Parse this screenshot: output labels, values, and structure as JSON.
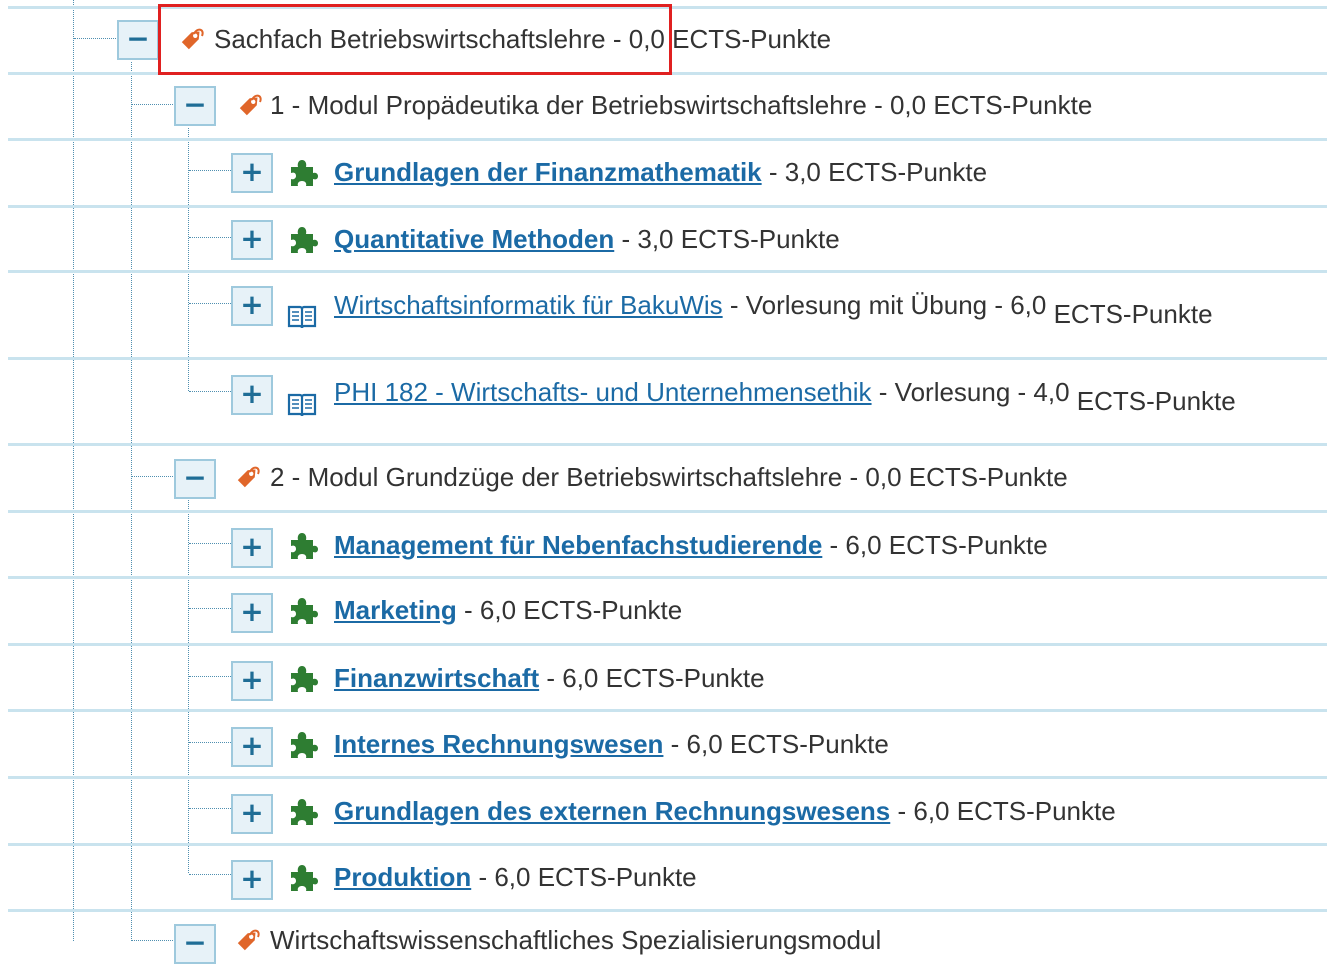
{
  "tree": {
    "root": {
      "toggle": "−",
      "label": "Sachfach Betriebswirtschaftslehre",
      "credits": " - 0,0 ECTS-Punkte",
      "highlighted": true
    },
    "modules": [
      {
        "toggle": "−",
        "label": "1 - Modul Propädeutika der Betriebswirtschaftslehre",
        "credits": " - 0,0 ECTS-Punkte",
        "children": [
          {
            "toggle": "+",
            "icon": "puzzle-piece-icon",
            "title": "Grundlagen der Finanzmathematik",
            "suffix": " - 3,0 ECTS-Punkte"
          },
          {
            "toggle": "+",
            "icon": "puzzle-piece-icon",
            "title": "Quantitative Methoden",
            "suffix": " - 3,0 ECTS-Punkte"
          },
          {
            "toggle": "+",
            "icon": "open-book-icon",
            "title": "Wirtschaftsinformatik für BakuWis",
            "suffix": " - Vorlesung mit Übung - 6,0",
            "suffix2": "ECTS-Punkte"
          },
          {
            "toggle": "+",
            "icon": "open-book-icon",
            "title": "PHI 182 - Wirtschafts- und Unternehmensethik",
            "suffix": " - Vorlesung - 4,0",
            "suffix2": "ECTS-Punkte"
          }
        ]
      },
      {
        "toggle": "−",
        "label": "2 - Modul Grundzüge der Betriebswirtschaftslehre",
        "credits": " - 0,0 ECTS-Punkte",
        "children": [
          {
            "toggle": "+",
            "icon": "puzzle-piece-icon",
            "title": "Management für Nebenfachstudierende",
            "suffix": " - 6,0 ECTS-Punkte"
          },
          {
            "toggle": "+",
            "icon": "puzzle-piece-icon",
            "title": "Marketing",
            "suffix": " - 6,0 ECTS-Punkte"
          },
          {
            "toggle": "+",
            "icon": "puzzle-piece-icon",
            "title": "Finanzwirtschaft",
            "suffix": " - 6,0 ECTS-Punkte"
          },
          {
            "toggle": "+",
            "icon": "puzzle-piece-icon",
            "title": "Internes Rechnungswesen",
            "suffix": " - 6,0 ECTS-Punkte"
          },
          {
            "toggle": "+",
            "icon": "puzzle-piece-icon",
            "title": "Grundlagen des externen Rechnungswesens",
            "suffix": " - 6,0 ECTS-Punkte"
          },
          {
            "toggle": "+",
            "icon": "puzzle-piece-icon",
            "title": "Produktion",
            "suffix": " - 6,0 ECTS-Punkte"
          }
        ]
      },
      {
        "toggle": "−",
        "label": "Wirtschaftswissenschaftliches Spezialisierungsmodul"
      }
    ]
  },
  "colors": {
    "link": "#1b6aa5",
    "puzzle": "#2e7d32",
    "tag": "#e0662a",
    "highlight_border": "#e02020",
    "separator": "#c9e3ee"
  }
}
